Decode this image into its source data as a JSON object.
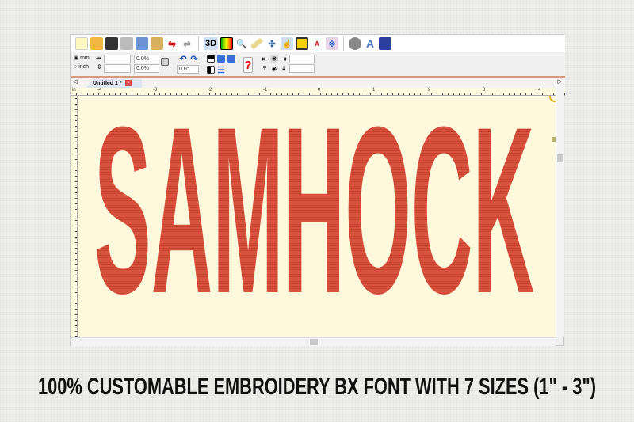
{
  "toolbar": {
    "icons": [
      "new-file",
      "open-folder",
      "save",
      "print",
      "copy",
      "paste",
      "mirror-horizontal",
      "mirror-vertical",
      "3d-view",
      "color-chart",
      "zoom",
      "measure",
      "stitch-tool",
      "select-pointer",
      "frame",
      "color-sequence",
      "network",
      "settings",
      "lettering",
      "thread-spool"
    ],
    "label_3d": "3D",
    "label_a": "A"
  },
  "units": {
    "mm": "mm",
    "inch": "inch",
    "selected": "mm"
  },
  "fields": {
    "width": "",
    "height": "",
    "scale_x": "0.0%",
    "scale_y": "0.0%",
    "rotation": "0.0°",
    "align_x": "",
    "align_y": ""
  },
  "help_label": "?",
  "tab": {
    "title": "Untitled 1 *",
    "close": "×"
  },
  "ruler": {
    "labels": [
      "-4",
      "-3",
      "-2",
      "-1",
      "0",
      "1",
      "2",
      "3",
      "4"
    ],
    "unit": "in"
  },
  "compass": "N",
  "design": {
    "text": "SAMHOCK",
    "color": "#d9523e"
  },
  "caption": "100% CUSTOMABLE EMBROIDERY BX FONT WITH 7 SIZES (1\" -  3\")"
}
